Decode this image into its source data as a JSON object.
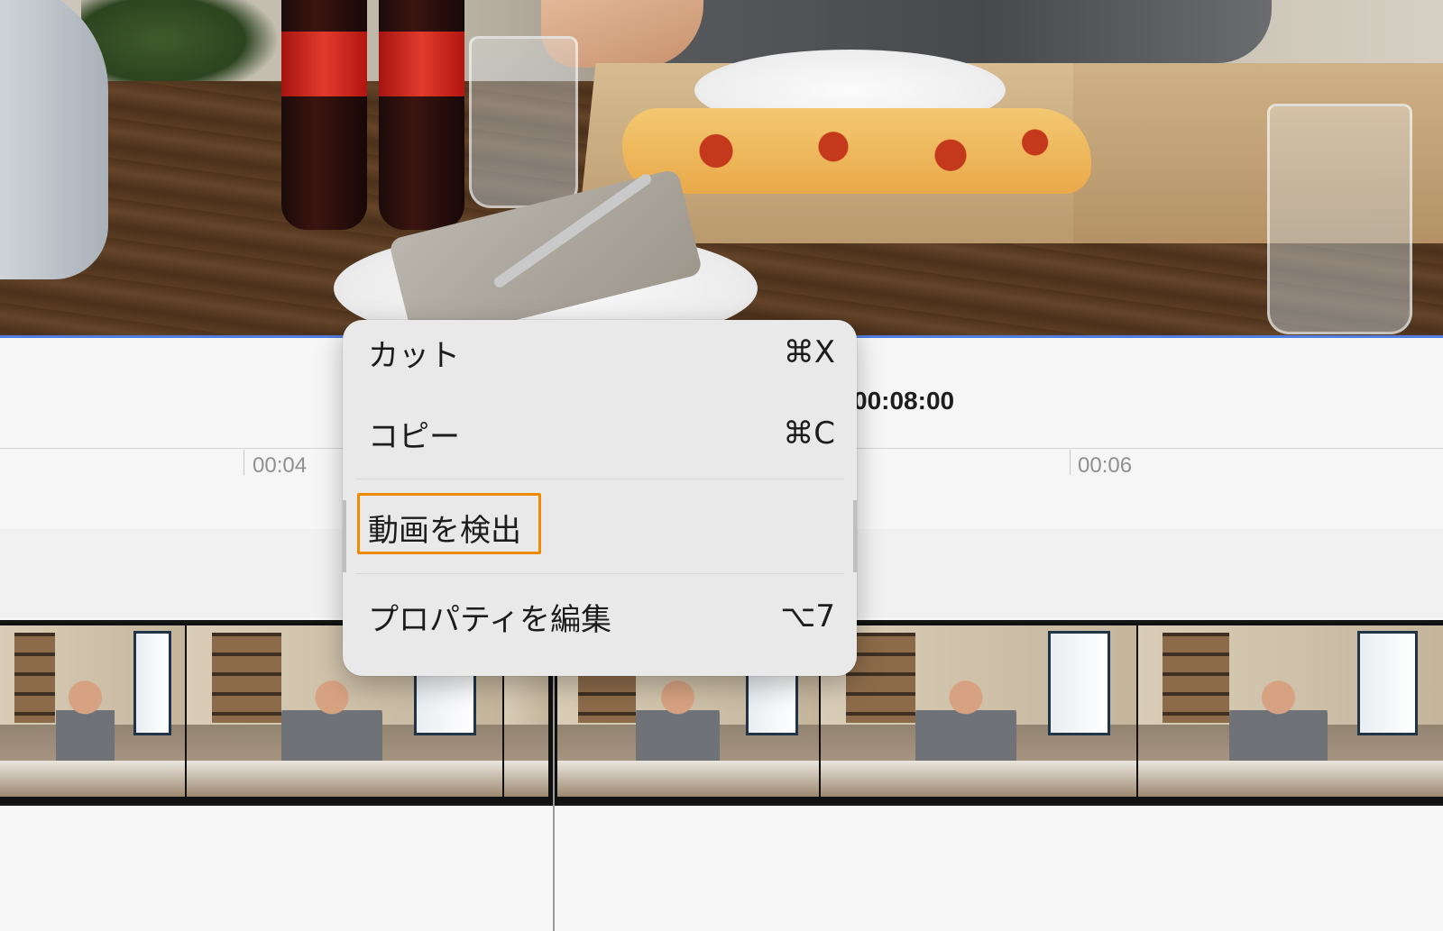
{
  "timeline": {
    "current_timecode": "00:08:00",
    "ruler_labels": [
      "00:04",
      "00:06"
    ]
  },
  "context_menu": {
    "items": [
      {
        "label": "カット",
        "shortcut": "⌘X"
      },
      {
        "label": "コピー",
        "shortcut": "⌘C"
      },
      {
        "label": "動画を検出",
        "shortcut": ""
      },
      {
        "label": "プロパティを編集",
        "shortcut": "⌥7"
      }
    ],
    "highlighted_item": "動画を検出"
  },
  "colors": {
    "highlight_border": "#f08a00",
    "preview_edge": "#4f7ede",
    "menu_background": "#e9e9e9"
  }
}
